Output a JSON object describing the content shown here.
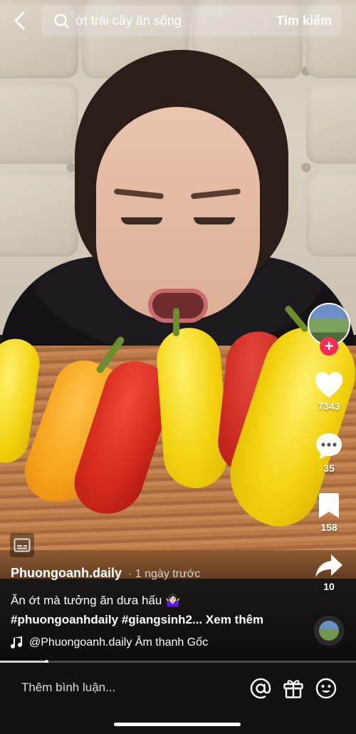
{
  "search": {
    "query": "ớt trái cây ăn sống",
    "submit_label": "Tìm kiếm"
  },
  "actions": {
    "likes": "7343",
    "comments": "35",
    "saves": "158",
    "shares": "10",
    "follow_symbol": "+"
  },
  "post": {
    "author": "Phuongoanh.daily",
    "time": "· 1 ngày trước",
    "caption": "Ăn ớt mà tưởng ăn dưa hấu 🤷🏻‍♀️",
    "hashtags": "#phuongoanhdaily #giangsinh2...",
    "see_more": "Xem thêm",
    "music": "@Phuongoanh.daily Âm thanh Gốc"
  },
  "playback": {
    "progress_fraction": 0.13
  },
  "comment_bar": {
    "placeholder": "Thêm bình luận..."
  },
  "colors": {
    "follow_accent": "#fe2c55",
    "background": "#000000"
  },
  "icons": {
    "back": "chevron-left-icon",
    "search": "search-icon",
    "like": "heart-icon",
    "comment": "comment-bubble-icon",
    "save": "bookmark-icon",
    "share": "share-arrow-icon",
    "captions": "captions-icon",
    "music": "music-note-icon",
    "mention": "at-sign-icon",
    "gift": "gift-icon",
    "emoji": "emoji-icon"
  }
}
